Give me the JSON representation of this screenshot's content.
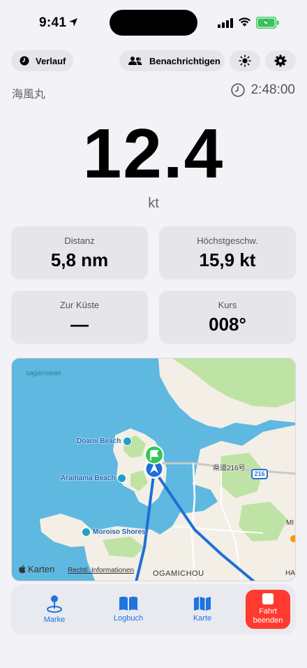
{
  "status": {
    "time": "9:41"
  },
  "toolbar": {
    "history_label": "Verlauf",
    "notify_label": "Benachrichtigen"
  },
  "trip": {
    "vessel": "海風丸",
    "elapsed": "2:48:00",
    "speed": "12.4",
    "speed_unit": "kt"
  },
  "stats": [
    {
      "label": "Distanz",
      "value": "5,8 nm"
    },
    {
      "label": "Höchstgeschw.",
      "value": "15,9 kt"
    },
    {
      "label": "Zur Küste",
      "value": "—"
    },
    {
      "label": "Kurs",
      "value": "008°"
    }
  ],
  "map": {
    "sea_label": "sagamiwan",
    "pois": [
      "Doami Beach",
      "Araihama Beach",
      "Moroiso Shores"
    ],
    "road_label": "県道216号",
    "road_badge": "216",
    "city": "OGAMICHOU",
    "edge_label_bottom": "HARAI",
    "edge_label_mid": "MI",
    "attribution": "Karten",
    "legal": "Rechtl. Informationen",
    "colors": {
      "sea": "#5fb8e0",
      "land": "#f3efe6",
      "green": "#bfe3a5",
      "route": "#1f6fd8"
    }
  },
  "tabs": {
    "marke": "Marke",
    "logbuch": "Logbuch",
    "karte": "Karte",
    "end_line1": "Fahrt",
    "end_line2": "beenden"
  }
}
